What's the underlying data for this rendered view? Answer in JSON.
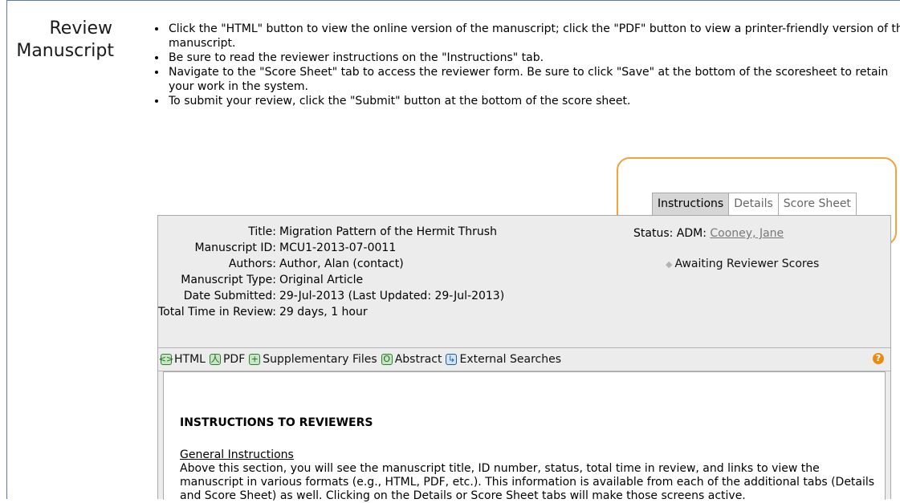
{
  "heading": {
    "line1": "Review",
    "line2": "Manuscript"
  },
  "bullets": [
    "Click the \"HTML\" button to view the online version of the manuscript; click the \"PDF\" button to view a printer-friendly version of the manuscript.",
    "Be sure to read the reviewer instructions on the \"Instructions\" tab.",
    "Navigate to the \"Score Sheet\" tab to access the reviewer form. Be sure to click \"Save\" at the bottom of the scoresheet to retain your work in the system.",
    "To submit your review, click the \"Submit\" button at the bottom of the score sheet."
  ],
  "tabs": [
    {
      "label": "Instructions",
      "active": true
    },
    {
      "label": "Details",
      "active": false
    },
    {
      "label": "Score Sheet",
      "active": false
    }
  ],
  "manuscript": {
    "title_label": "Title:",
    "title": "Migration Pattern of the Hermit Thrush",
    "id_label": "Manuscript ID:",
    "id": "MCU1-2013-07-0011",
    "authors_label": "Authors:",
    "authors": "Author, Alan (contact)",
    "type_label": "Manuscript Type:",
    "type": "Original Article",
    "date_label": "Date Submitted:",
    "date": "29-Jul-2013 (Last Updated: 29-Jul-2013)",
    "time_label": "Total Time in Review:",
    "time": "29 days, 1 hour"
  },
  "status": {
    "label": "Status: ADM:",
    "admin_link": "Cooney, Jane",
    "awaiting": "Awaiting Reviewer Scores"
  },
  "toolbar": {
    "html": "HTML",
    "pdf": "PDF",
    "supplementary": "Supplementary Files",
    "abstract": "Abstract",
    "external": "External Searches",
    "help_icon": "?"
  },
  "instructions": {
    "title": "INSTRUCTIONS TO REVIEWERS",
    "general_heading": "General Instructions",
    "general_text": "Above this section, you will see the manuscript title, ID number, status, total time in review, and links to view the manuscript in various formats (e.g., HTML, PDF, etc.). This information is available from each of the additional tabs (Details and Score Sheet) as well. Clicking on the Details or Score Sheet tabs will make those screens active."
  },
  "colors": {
    "highlight": "#f2a33a",
    "link": "#777777",
    "panel_bg": "#ececec",
    "active_tab_bg": "#d6d6d6"
  }
}
